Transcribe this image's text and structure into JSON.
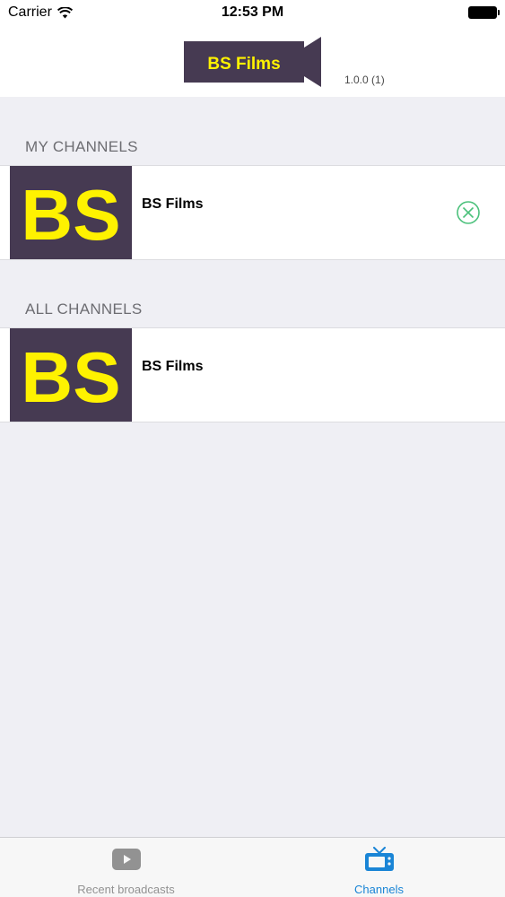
{
  "status_bar": {
    "carrier": "Carrier",
    "time": "12:53 PM"
  },
  "header": {
    "logo_text": "BS Films",
    "version": "1.0.0 (1)"
  },
  "sections": {
    "my_channels": {
      "title": "MY CHANNELS",
      "items": [
        {
          "name": "BS Films",
          "thumb_text": "BS"
        }
      ]
    },
    "all_channels": {
      "title": "ALL CHANNELS",
      "items": [
        {
          "name": "BS Films",
          "thumb_text": "BS"
        }
      ]
    }
  },
  "tab_bar": {
    "tabs": [
      {
        "label": "Recent broadcasts",
        "icon": "play-icon",
        "active": false
      },
      {
        "label": "Channels",
        "icon": "tv-icon",
        "active": true
      }
    ]
  },
  "colors": {
    "brand_dark": "#463a52",
    "brand_yellow": "#fff200",
    "remove_green": "#4cc17c",
    "active_tab": "#1a85d6",
    "inactive_tab": "#929292"
  }
}
